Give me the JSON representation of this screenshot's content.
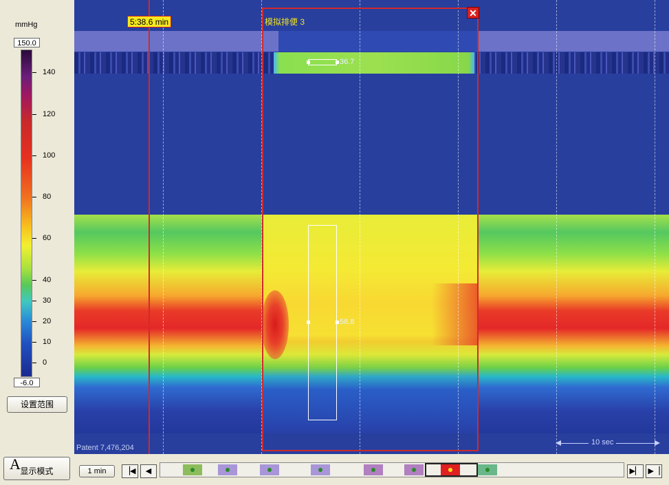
{
  "scale": {
    "unit": "mmHg",
    "max": "150.0",
    "min": "-6.0",
    "ticks": [
      "140",
      "120",
      "100",
      "80",
      "60",
      "40",
      "30",
      "20",
      "10",
      "0"
    ]
  },
  "buttons": {
    "set_range": "设置范围",
    "display_mode_letter": "A",
    "display_mode": "显示模式",
    "one_min": "1 min"
  },
  "plot": {
    "time_badge": "5:38.6 min",
    "event_title": "模拟排便 3",
    "roi_small_value": "36.7",
    "roi_big_value": "58.8",
    "patient_label": "Patent 7,476,204",
    "scale_bar_label": "10 sec"
  },
  "timeline": {
    "events": [
      {
        "color": "#8cbc5c",
        "dot": "green"
      },
      {
        "color": "#a896d8",
        "dot": "green"
      },
      {
        "color": "#a896d8",
        "dot": "green"
      },
      {
        "color": "#a896d8",
        "dot": "green"
      },
      {
        "color": "#b080c0",
        "dot": "green"
      },
      {
        "color": "#b080c0",
        "dot": "green"
      },
      {
        "color": "#e02020",
        "dot": "yellow"
      },
      {
        "color": "#6ab88a",
        "dot": "green"
      }
    ]
  },
  "colors": {
    "background": "#283f9e",
    "marker": "#d22a2a",
    "event_title": "#f0e020"
  }
}
